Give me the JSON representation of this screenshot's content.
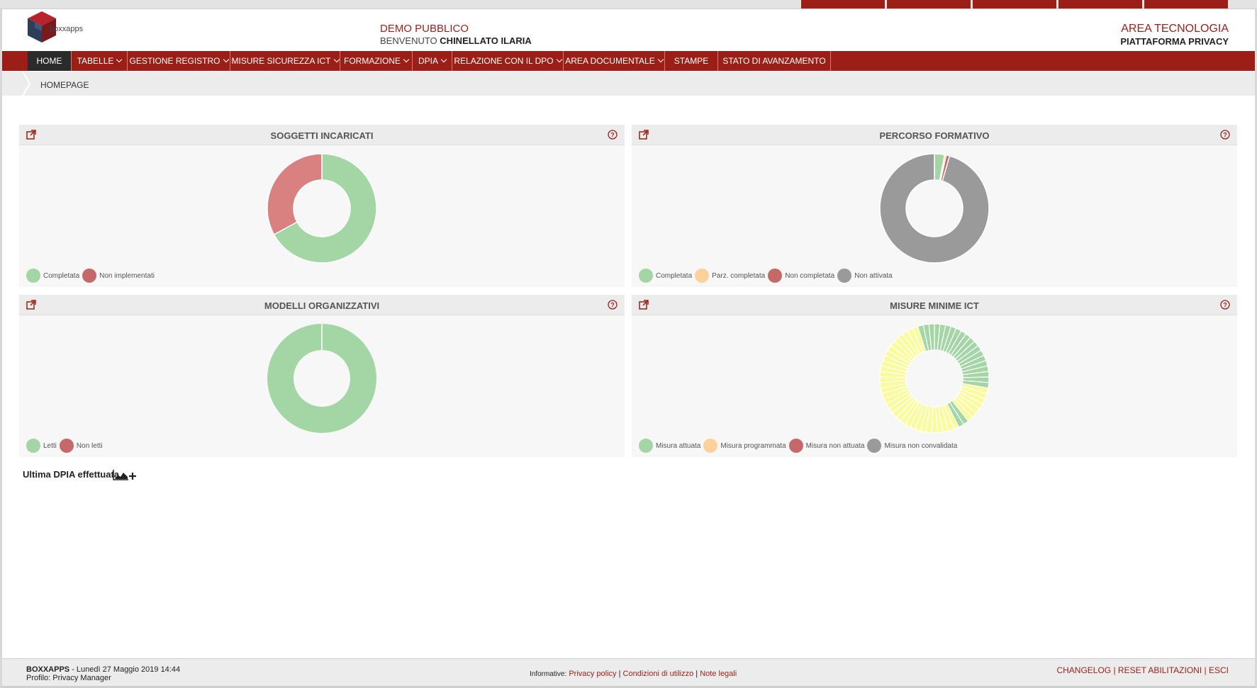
{
  "header": {
    "logo_text": "boxxapps",
    "demo_title": "DEMO PUBBLICO",
    "welcome_prefix": "BENVENUTO",
    "user_name": "CHINELLATO ILARIA",
    "area_title": "AREA TECNOLOGIA",
    "platform": "PIATTAFORMA PRIVACY"
  },
  "nav": {
    "items": [
      {
        "label": "HOME",
        "dropdown": false,
        "active": true
      },
      {
        "label": "TABELLE",
        "dropdown": true
      },
      {
        "label": "GESTIONE REGISTRO",
        "dropdown": true
      },
      {
        "label": "MISURE SICUREZZA ICT",
        "dropdown": true
      },
      {
        "label": "FORMAZIONE",
        "dropdown": true
      },
      {
        "label": "DPIA",
        "dropdown": true
      },
      {
        "label": "RELAZIONE CON IL DPO",
        "dropdown": true
      },
      {
        "label": "AREA DOCUMENTALE",
        "dropdown": true
      },
      {
        "label": "STAMPE",
        "dropdown": false
      },
      {
        "label": "STATO DI AVANZAMENTO",
        "dropdown": false
      }
    ]
  },
  "breadcrumb": "HOMEPAGE",
  "colors": {
    "brand": "#9b1f16",
    "green": "#a3d6a4",
    "red": "#d98080",
    "dark_red": "#c56868",
    "orange": "#fdd19c",
    "gray": "#9a9a9a",
    "yellow": "#fbfb9e"
  },
  "panels": [
    {
      "title": "SOGGETTI INCARICATI",
      "legend": [
        {
          "label": "Completata",
          "color": "#a3d6a4"
        },
        {
          "label": "Non implementati",
          "color": "#c56868"
        }
      ],
      "chart_data": {
        "type": "pie",
        "donut": true,
        "labels": [
          "Completata",
          "Non implementati"
        ],
        "values": [
          67,
          33
        ],
        "colors": [
          "#a3d6a4",
          "#d98080"
        ]
      }
    },
    {
      "title": "PERCORSO FORMATIVO",
      "legend": [
        {
          "label": "Completata",
          "color": "#a3d6a4"
        },
        {
          "label": "Parz. completata",
          "color": "#fdd19c"
        },
        {
          "label": "Non completata",
          "color": "#c56868"
        },
        {
          "label": "Non attivata",
          "color": "#9a9a9a"
        }
      ],
      "chart_data": {
        "type": "pie",
        "donut": true,
        "labels": [
          "Completata",
          "Parz. completata",
          "Non completata",
          "Non attivata"
        ],
        "values": [
          3,
          0.5,
          1,
          95.5
        ],
        "colors": [
          "#a3d6a4",
          "#fdd19c",
          "#c56868",
          "#9a9a9a"
        ]
      }
    },
    {
      "title": "MODELLI ORGANIZZATIVI",
      "legend": [
        {
          "label": "Letti",
          "color": "#a3d6a4"
        },
        {
          "label": "Non letti",
          "color": "#c56868"
        }
      ],
      "chart_data": {
        "type": "pie",
        "donut": true,
        "labels": [
          "Letti",
          "Non letti"
        ],
        "values": [
          100,
          0
        ],
        "colors": [
          "#a3d6a4",
          "#d98080"
        ]
      }
    },
    {
      "title": "MISURE MINIME ICT",
      "legend": [
        {
          "label": "Misura attuata",
          "color": "#a3d6a4"
        },
        {
          "label": "Misura programmata",
          "color": "#fdd19c"
        },
        {
          "label": "Misura non attuata",
          "color": "#c56868"
        },
        {
          "label": "Misura non convalidata",
          "color": "#9a9a9a"
        }
      ],
      "chart_data": {
        "type": "pie",
        "donut": true,
        "segmented": true,
        "segment_colors": [
          "green",
          "green",
          "green",
          "green",
          "green",
          "green",
          "green",
          "green",
          "green",
          "green",
          "green",
          "green",
          "green",
          "green",
          "green",
          "green",
          "green",
          "yellow",
          "yellow",
          "yellow",
          "yellow",
          "yellow",
          "yellow",
          "yellow",
          "green",
          "green",
          "yellow",
          "yellow",
          "yellow",
          "yellow",
          "yellow",
          "yellow",
          "yellow",
          "yellow",
          "yellow",
          "yellow",
          "yellow",
          "yellow",
          "yellow",
          "yellow",
          "yellow",
          "yellow",
          "yellow",
          "yellow",
          "yellow",
          "yellow",
          "yellow",
          "yellow",
          "yellow",
          "yellow",
          "yellow",
          "yellow",
          "yellow",
          "yellow",
          "yellow",
          "yellow",
          "yellow",
          "yellow",
          "green",
          "green",
          "green"
        ],
        "labels": [
          "Misura attuata",
          "Misura programmata",
          "Misura non attuata",
          "Misura non convalidata"
        ]
      }
    }
  ],
  "dpia": {
    "label": "Ultima DPIA effettuata"
  },
  "footer": {
    "brand": "BOXXAPPS",
    "date_text": " - Lunedì 27 Maggio 2019 14:44",
    "profile": "Profilo: Privacy Manager",
    "informative_label": "Informative:",
    "links": [
      "Privacy policy",
      "Condizioni di utilizzo",
      "Note legali"
    ],
    "right_links": [
      "CHANGELOG",
      "RESET ABILITAZIONI",
      "ESCI"
    ]
  }
}
